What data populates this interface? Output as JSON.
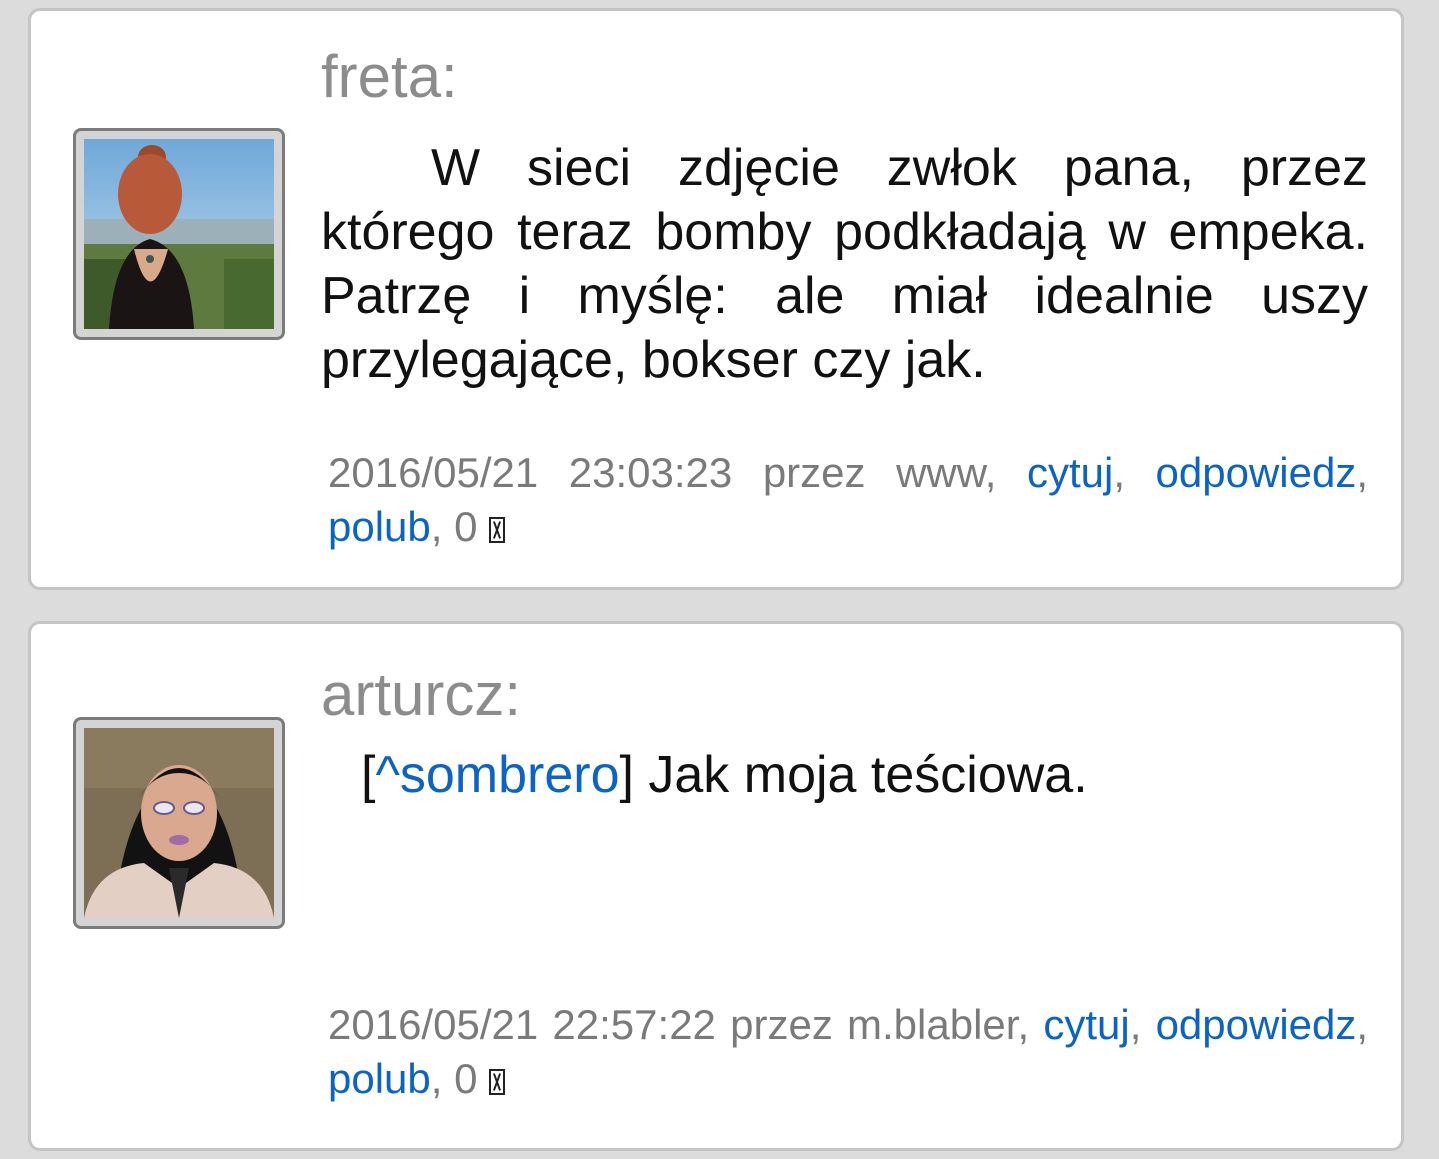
{
  "comments": [
    {
      "author": "freta:",
      "avatar_icon": "avatar-woman-back-view",
      "text": "W sieci zdjęcie zwłok pana, przez którego teraz bomby podkładają w empeka. Patrzę i myślę: ale miał idealnie uszy przylegające, bokser czy jak.",
      "meta": {
        "date": "2016/05/21",
        "time": "23:03:23",
        "by_label": "przez",
        "by_user": "www,",
        "quote_label": "cytuj",
        "reply_label": "odpowiedz",
        "like_label": "polub",
        "likes": "0"
      }
    },
    {
      "author": "arturcz:",
      "avatar_icon": "avatar-dark-hair-portrait",
      "mention": "^sombrero",
      "text": "Jak moja teściowa.",
      "meta": {
        "date": "2016/05/21",
        "time": "22:57:22",
        "by_label": "przez",
        "by_user": "m.blabler,",
        "quote_label": "cytuj",
        "reply_label": "odpowiedz",
        "like_label": "polub",
        "likes": "0"
      }
    }
  ],
  "colors": {
    "link": "#0b63c5",
    "meta_text": "#7a7a7a",
    "author": "#8c8c8c",
    "background": "#dcdcdc"
  }
}
